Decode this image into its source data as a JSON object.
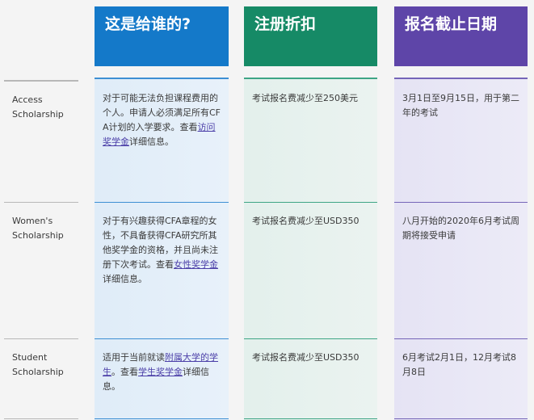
{
  "headers": {
    "who": "这是给谁的?",
    "discount": "注册折扣",
    "deadline": "报名截止日期"
  },
  "rows": [
    {
      "label_line1": "Access",
      "label_line2": "Scholarship",
      "who_before": "对于可能无法负担课程费用的个人。申请人必须满足所有CFA计划的入学要求。查看",
      "who_link": "访问奖学金",
      "who_after": "详细信息。",
      "discount": "考试报名费减少至250美元",
      "deadline": "3月1日至9月15日，用于第二年的考试"
    },
    {
      "label_line1": "Women's",
      "label_line2": "Scholarship",
      "who_before": "对于有兴趣获得CFA章程的女性，不具备获得CFA研究所其他奖学金的资格，并且尚未注册下次考试。查看",
      "who_link": "女性奖学金",
      "who_after": "详细信息。",
      "discount": "考试报名费减少至USD350",
      "deadline": "八月开始的2020年6月考试周期将接受申请"
    },
    {
      "label_line1": "Student",
      "label_line2": "Scholarship",
      "who_before": "适用于当前就读",
      "who_link": "附属大学的学生",
      "who_middle": "。查看",
      "who_link2": "学生奖学金",
      "who_after": "详细信息。",
      "discount": "考试报名费减少至USD350",
      "deadline": "6月考试2月1日，12月考试8月8日"
    }
  ]
}
